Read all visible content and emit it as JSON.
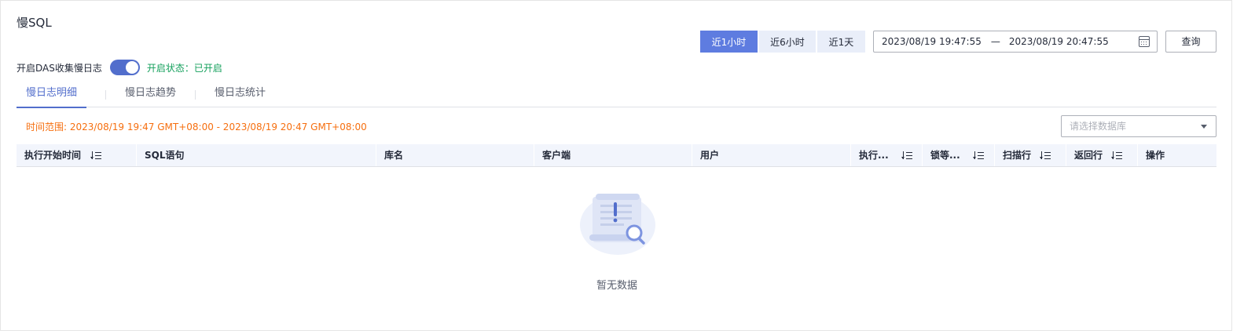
{
  "page": {
    "title": "慢SQL"
  },
  "das": {
    "toggle_label": "开启DAS收集慢日志",
    "enabled": true,
    "status_text": "开启状态：已开启",
    "toggle_color": "#526ecc",
    "status_color": "#14a05c"
  },
  "time_buttons": {
    "items": [
      {
        "label": "近1小时",
        "active": true
      },
      {
        "label": "近6小时",
        "active": false
      },
      {
        "label": "近1天",
        "active": false
      }
    ],
    "active_color": "#5e7ce0"
  },
  "date_range": {
    "start": "2023/08/19 19:47:55",
    "separator": "—",
    "end": "2023/08/19 20:47:55"
  },
  "query_button": {
    "label": "查询"
  },
  "tabs": {
    "items": [
      {
        "label": "慢日志明细",
        "active": true
      },
      {
        "label": "慢日志趋势",
        "active": false
      },
      {
        "label": "慢日志统计",
        "active": false
      }
    ]
  },
  "filter": {
    "time_range_text": "时间范围: 2023/08/19 19:47 GMT+08:00 - 2023/08/19 20:47 GMT+08:00",
    "time_range_color": "#f66f0f",
    "db_placeholder": "请选择数据库"
  },
  "table": {
    "columns": [
      {
        "label": "执行开始时间",
        "sortable": true
      },
      {
        "label": "SQL语句",
        "sortable": false
      },
      {
        "label": "库名",
        "sortable": false
      },
      {
        "label": "客户端",
        "sortable": false
      },
      {
        "label": "用户",
        "sortable": false
      },
      {
        "label": "执行...",
        "sortable": true
      },
      {
        "label": "锁等...",
        "sortable": true
      },
      {
        "label": "扫描行",
        "sortable": true
      },
      {
        "label": "返回行",
        "sortable": true
      },
      {
        "label": "操作",
        "sortable": false
      }
    ],
    "rows": [],
    "empty_text": "暂无数据"
  }
}
